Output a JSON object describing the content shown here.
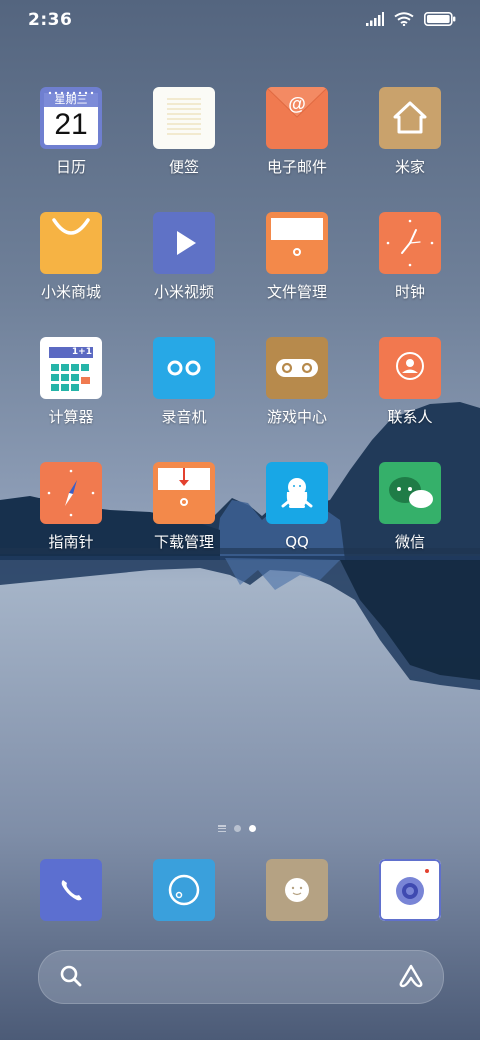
{
  "status_bar": {
    "time": "2:36",
    "icons": [
      "signal-icon",
      "wifi-icon",
      "battery-icon"
    ]
  },
  "apps": [
    {
      "name": "calendar",
      "label": "日历",
      "color": "#6f7fd0",
      "weekday": "星期三",
      "day": "21"
    },
    {
      "name": "notes",
      "label": "便签",
      "color": "#fbfbf6"
    },
    {
      "name": "email",
      "label": "电子邮件",
      "color": "#f07a50"
    },
    {
      "name": "mijia",
      "label": "米家",
      "color": "#c9a26c"
    },
    {
      "name": "mi-store",
      "label": "小米商城",
      "color": "#f6b344"
    },
    {
      "name": "mi-video",
      "label": "小米视频",
      "color": "#5f72c6"
    },
    {
      "name": "file-manager",
      "label": "文件管理",
      "color": "#f3894a"
    },
    {
      "name": "clock",
      "label": "时钟",
      "color": "#f17b4f"
    },
    {
      "name": "calculator",
      "label": "计算器",
      "color": "#ffffff",
      "display": "1+1"
    },
    {
      "name": "recorder",
      "label": "录音机",
      "color": "#27a8e6"
    },
    {
      "name": "game-center",
      "label": "游戏中心",
      "color": "#b78a4c"
    },
    {
      "name": "contacts",
      "label": "联系人",
      "color": "#f2784f"
    },
    {
      "name": "compass",
      "label": "指南针",
      "color": "#f17a4f"
    },
    {
      "name": "downloads",
      "label": "下载管理",
      "color": "#f3894a"
    },
    {
      "name": "qq",
      "label": "QQ",
      "color": "#18a7e6"
    },
    {
      "name": "wechat",
      "label": "微信",
      "color": "#35b06a"
    }
  ],
  "pager": {
    "pages": 3,
    "current": 3
  },
  "dock": [
    {
      "name": "phone",
      "color": "#5c6fd0"
    },
    {
      "name": "browser",
      "color": "#3aa0dc"
    },
    {
      "name": "messages",
      "color": "#b5a283"
    },
    {
      "name": "camera",
      "color": "#ffffff"
    }
  ],
  "search": {
    "icons": [
      "search-icon",
      "assistant-icon"
    ]
  }
}
